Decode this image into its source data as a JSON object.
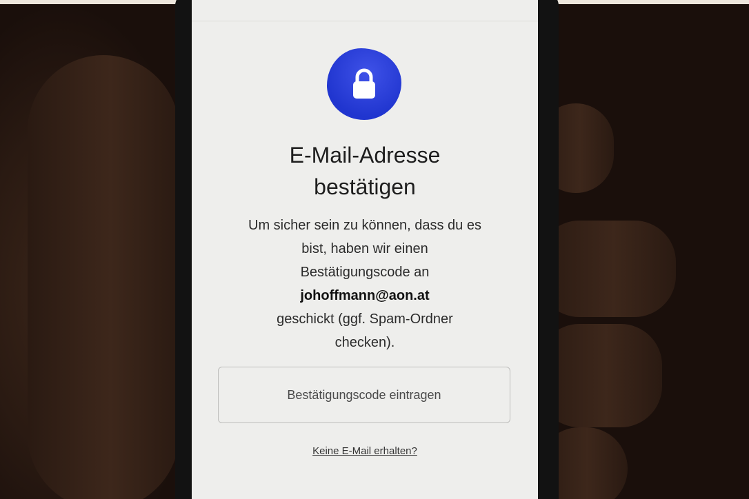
{
  "icon": {
    "name": "lock-icon",
    "badge_color": "#2a3fdc"
  },
  "title_line1": "E-Mail-Adresse",
  "title_line2": "bestätigen",
  "description": {
    "line1": "Um sicher sein zu können, dass du es",
    "line2": "bist, haben wir einen",
    "line3": "Bestätigungscode an",
    "email": "johoffmann@aon.at",
    "line5": "geschickt (ggf. Spam-Ordner",
    "line6": "checken)."
  },
  "code_input": {
    "placeholder": "Bestätigungscode eintragen",
    "value": ""
  },
  "resend_link": "Keine E-Mail erhalten?"
}
